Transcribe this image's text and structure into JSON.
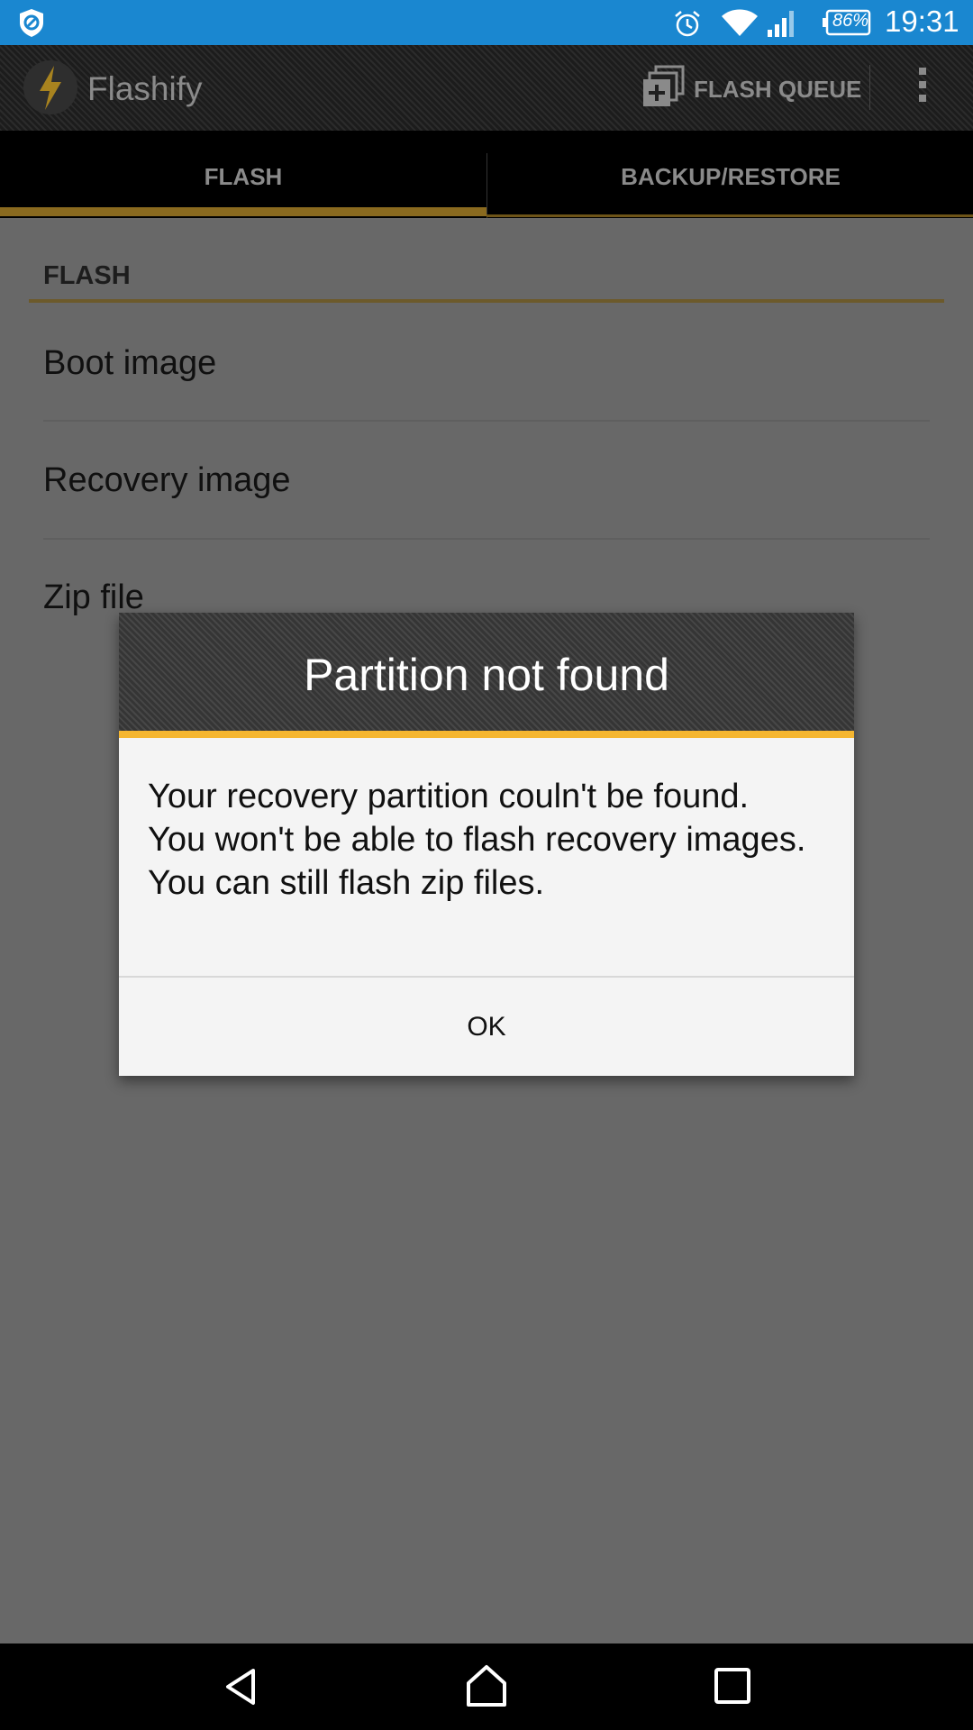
{
  "status_bar": {
    "battery": "86%",
    "time": "19:31",
    "icons": [
      "shield-icon",
      "alarm-icon",
      "wifi-icon",
      "signal-icon",
      "battery-icon"
    ],
    "background_color": "#1a87d0"
  },
  "action_bar": {
    "app_title": "Flashify",
    "flash_queue_label": "FLASH QUEUE",
    "icons": [
      "flashify-logo-icon",
      "flash-queue-icon",
      "overflow-menu-icon"
    ]
  },
  "tabs": [
    {
      "label": "FLASH",
      "selected": true
    },
    {
      "label": "BACKUP/RESTORE",
      "selected": false
    }
  ],
  "content": {
    "section_header": "FLASH",
    "items": [
      {
        "label": "Boot image"
      },
      {
        "label": "Recovery image"
      },
      {
        "label": "Zip file"
      }
    ]
  },
  "dialog": {
    "title": "Partition not found",
    "message_lines": [
      "Your recovery partition couln't be found.",
      "You won't be able to flash recovery images.",
      "You can still flash zip files."
    ],
    "ok_label": "OK",
    "accent_color": "#f5b630"
  },
  "nav_bar": {
    "icons": [
      "back-icon",
      "home-icon",
      "recents-icon"
    ]
  }
}
